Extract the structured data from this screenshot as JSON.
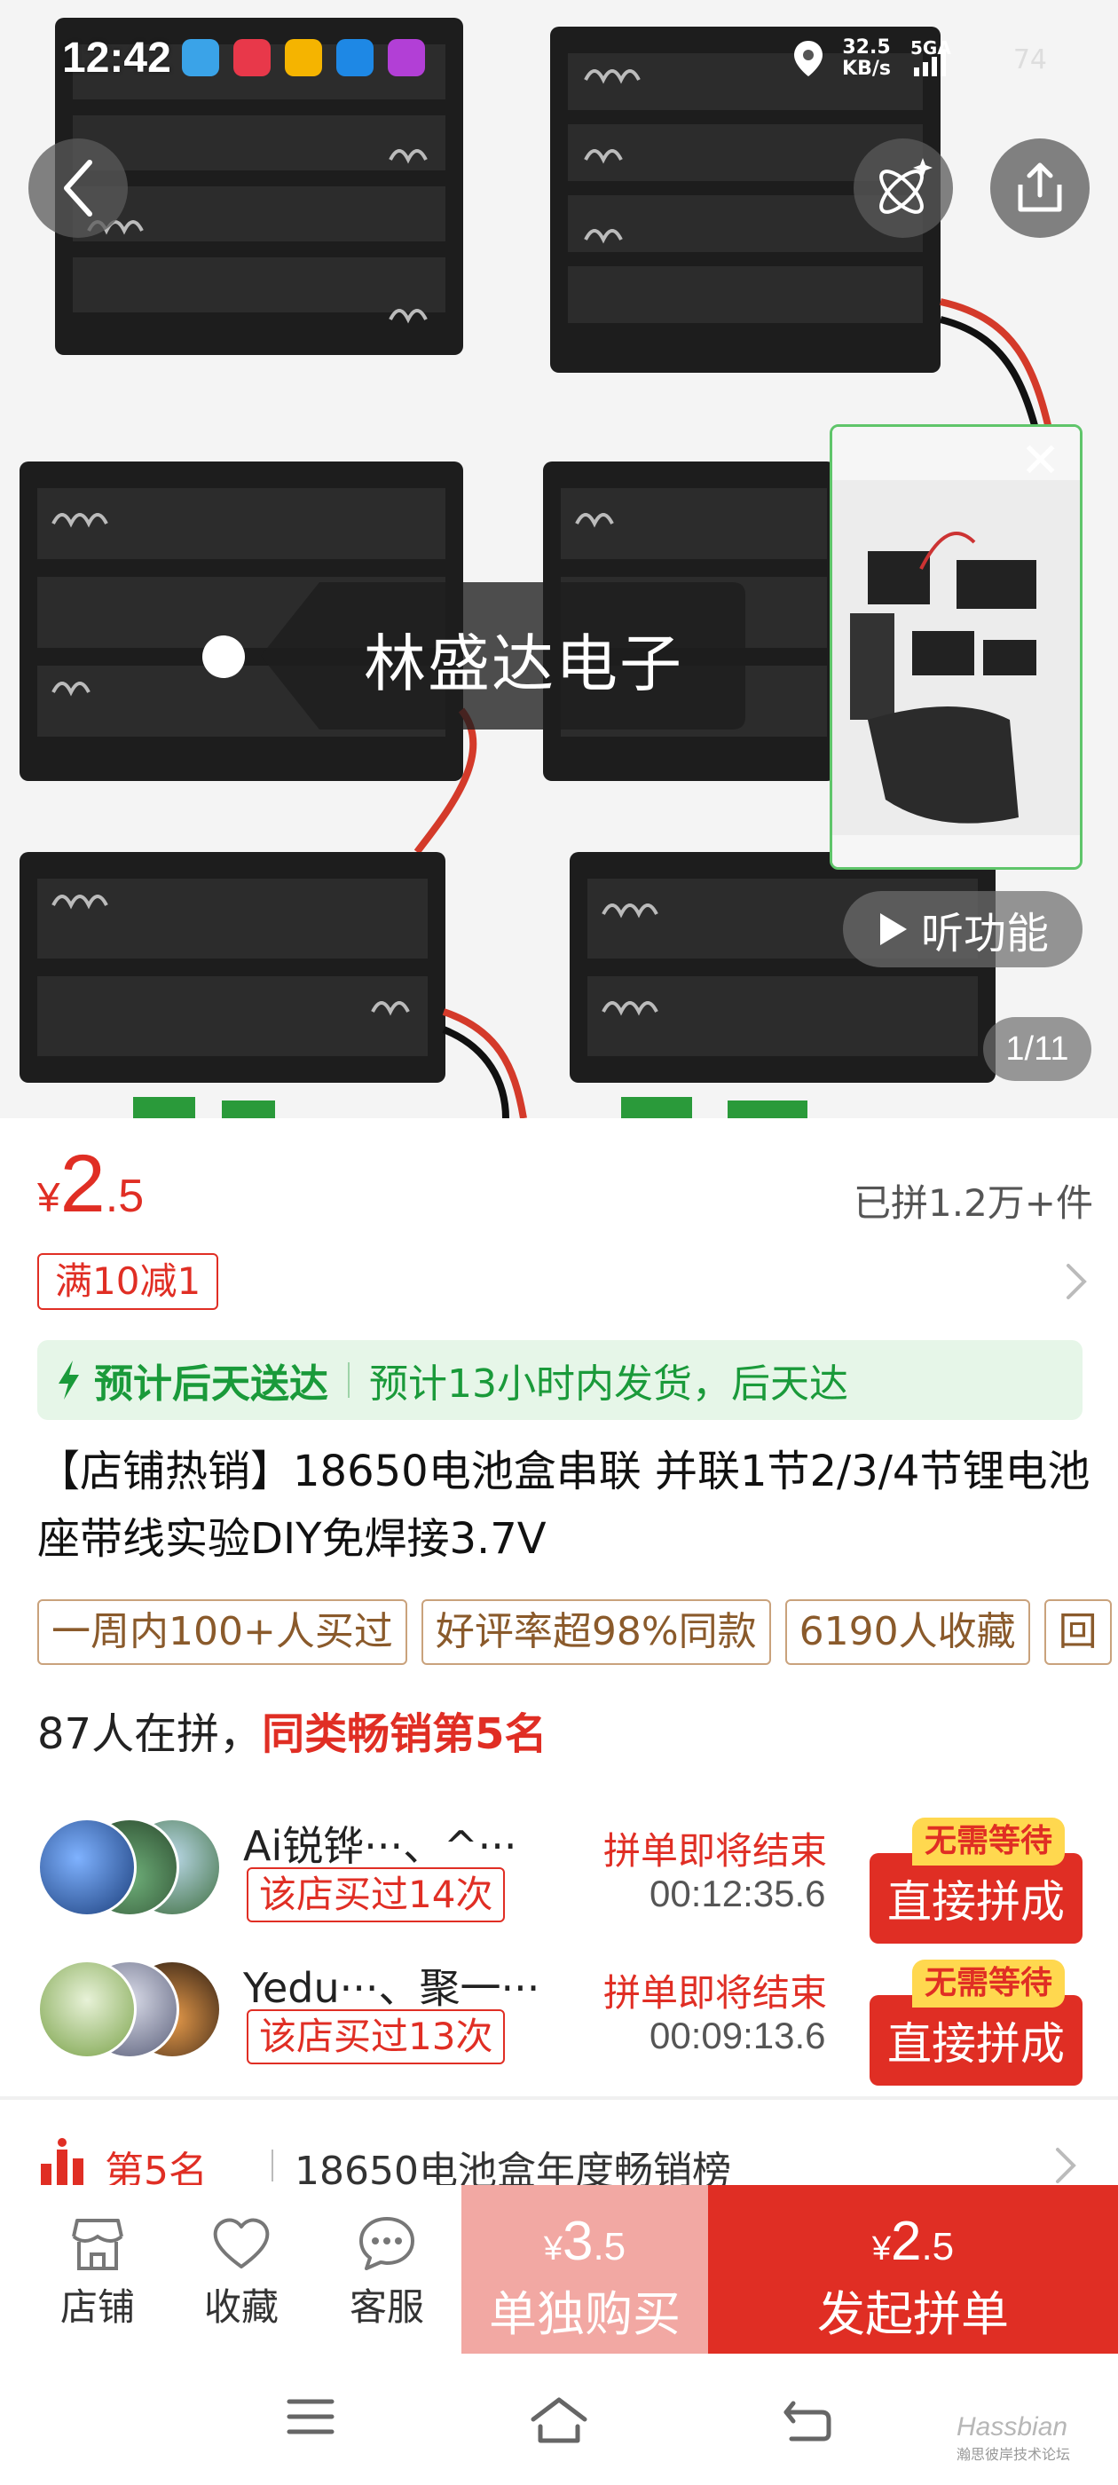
{
  "status_bar": {
    "time": "12:42",
    "net_speed_value": "32.5",
    "net_speed_unit": "KB/s",
    "network": "5GA",
    "battery": "74"
  },
  "gallery": {
    "shop_tag": "林盛达电子",
    "listen_label": "听功能",
    "counter": "1/11"
  },
  "price": {
    "currency": "¥",
    "integer": "2",
    "decimal": ".5",
    "sold": "已拼1.2万+件"
  },
  "coupon": "满10减1",
  "delivery": {
    "estimate": "预计后天送达",
    "detail": "预计13小时内发货，后天达"
  },
  "product_title": "【店铺热销】18650电池盒串联 并联1节2/3/4节锂电池座带线实验DIY免焊接3.7V",
  "tags": [
    "一周内100+人买过",
    "好评率超98%同款",
    "6190人收藏",
    "回"
  ],
  "group_buy": {
    "count_text": "87人在拼，",
    "rank_text": "同类畅销第5名",
    "groups": [
      {
        "name": "Ai锐铧···、^···",
        "bought": "该店买过14次",
        "ending": "拼单即将结束",
        "timer": "00:12:35.6",
        "badge": "无需等待",
        "button": "直接拼成"
      },
      {
        "name": "Yedu···、聚一···",
        "bought": "该店买过13次",
        "ending": "拼单即将结束",
        "timer": "00:09:13.6",
        "badge": "无需等待",
        "button": "直接拼成"
      }
    ]
  },
  "ranking": {
    "position": "第5名",
    "list": "18650电池盒年度畅销榜"
  },
  "bottom_bar": {
    "shop": "店铺",
    "favorite": "收藏",
    "service": "客服",
    "solo_price": {
      "currency": "¥",
      "integer": "3",
      "decimal": ".5"
    },
    "solo_label": "单独购买",
    "group_price": {
      "currency": "¥",
      "integer": "2",
      "decimal": ".5"
    },
    "group_label": "发起拼单"
  },
  "watermark": {
    "brand": "Hassbian",
    "sub": "瀚思彼岸技术论坛"
  },
  "colors": {
    "brand_red": "#e02e24",
    "solo_pink": "#f2a8a3",
    "delivery_green": "#1a9a3a",
    "delivery_bg": "#e6f6e8"
  }
}
